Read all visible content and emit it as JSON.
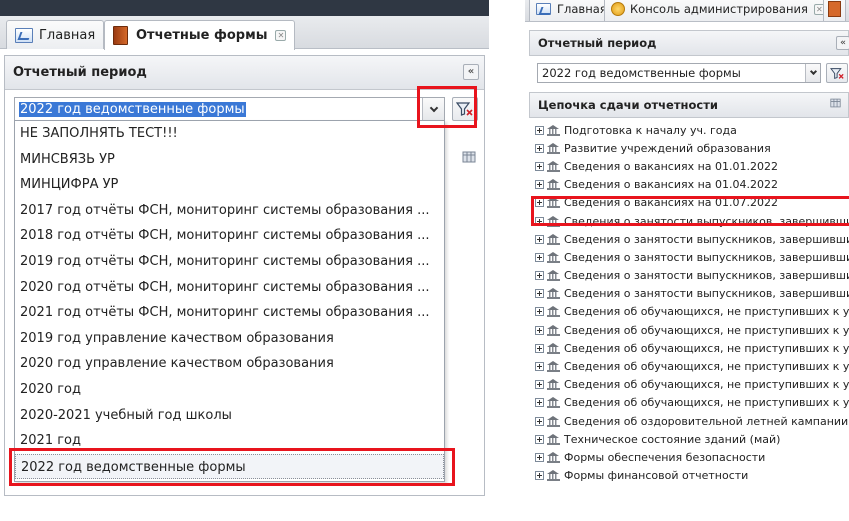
{
  "left": {
    "tabs": [
      {
        "label": "Главная",
        "icon": "home-icon"
      },
      {
        "label": "Отчетные формы",
        "icon": "forms-icon",
        "closable": true
      }
    ],
    "panel_title": "Отчетный период",
    "collapse_symbol": "«",
    "combo_value": "2022 год ведомственные формы",
    "dropdown_items": [
      "НЕ ЗАПОЛНЯТЬ ТЕСТ!!!",
      "МИНСВЯЗЬ УР",
      "МИНЦИФРА УР",
      "2017 год отчёты ФСН, мониторинг системы образования ...",
      "2018 год отчёты ФСН, мониторинг системы образования ...",
      "2019 год отчёты ФСН, мониторинг системы образования ...",
      "2020 год отчёты ФСН, мониторинг системы образования ...",
      "2021 год отчёты ФСН, мониторинг системы образования ...",
      "2019 год управление качеством образования",
      "2020 год управление качеством образования",
      "2020 год",
      "2020-2021 учебный год школы",
      "2021 год",
      "2022 год ведомственные формы"
    ],
    "selected_index": 13
  },
  "right": {
    "tabs": [
      {
        "label": "Главная",
        "icon": "home-icon"
      },
      {
        "label": "Консоль администрирования",
        "icon": "console-icon",
        "closable": true
      }
    ],
    "period_title": "Отчетный период",
    "combo_value": "2022 год ведомственные формы",
    "chain_title": "Цепочка сдачи отчетности",
    "tree_items": [
      "Подготовка к началу уч. года",
      "Развитие учреждений образования",
      "Сведения о вакансиях на 01.01.2022",
      "Сведения о вакансиях на 01.04.2022",
      "Сведения о вакансиях на 01.07.2022",
      "Сведения о занятости выпускников, завершивши",
      "Сведения о занятости выпускников, завершивши",
      "Сведения о занятости выпускников, завершивши",
      "Сведения о занятости выпускников, завершивши",
      "Сведения о занятости выпускников, завершивши",
      "Сведения об обучающихся, не приступивших к уч",
      "Сведения об обучающихся, не приступивших к уч",
      "Сведения об обучающихся, не приступивших к уч",
      "Сведения об обучающихся, не приступивших к уч",
      "Сведения об обучающихся, не приступивших к уч",
      "Сведения об обучающихся, не приступивших к уч",
      "Сведения об оздоровительной летней кампании",
      "Техническое состояние зданий (май)",
      "Формы обеспечения безопасности",
      "Формы финансовой отчетности"
    ],
    "highlighted_index": 4
  },
  "colors": {
    "highlight": "#e8141d",
    "combo_text": "#ffffff",
    "combo_selection": "#3a78d6"
  }
}
